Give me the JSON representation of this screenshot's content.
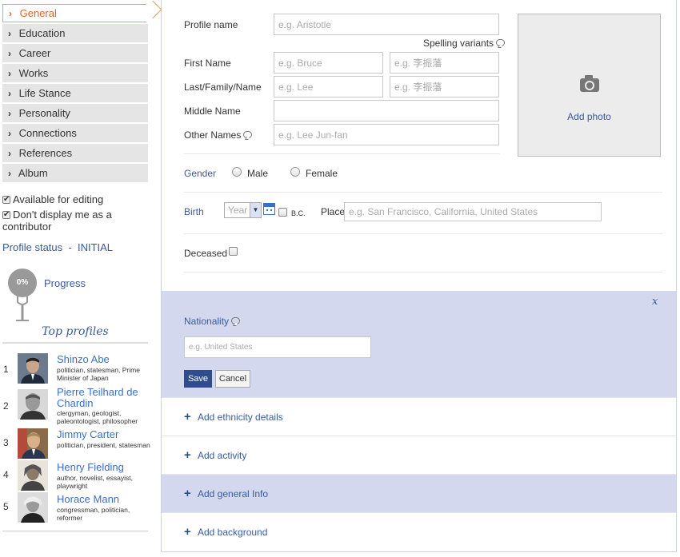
{
  "sidebar": {
    "nav": [
      {
        "label": "General",
        "active": true
      },
      {
        "label": "Education"
      },
      {
        "label": "Career"
      },
      {
        "label": "Works"
      },
      {
        "label": "Life Stance"
      },
      {
        "label": "Personality"
      },
      {
        "label": "Connections"
      },
      {
        "label": "References"
      },
      {
        "label": "Album"
      }
    ],
    "available_for_editing": "Available for editing",
    "dont_display": "Don't display me as a contributor",
    "profile_status_label": "Profile status",
    "profile_status_sep": "-",
    "profile_status_value": "INITIAL",
    "progress_badge": "0%",
    "progress_label": "Progress",
    "top_profiles_title": "Top profiles",
    "top_profiles": [
      {
        "rank": "1",
        "name": "Shinzo Abe",
        "desc": "politician, statesman, Prime Minister of Japan"
      },
      {
        "rank": "2",
        "name": "Pierre Teilhard de Chardin",
        "desc": "clergyman, geologist, paleontologist, philosopher"
      },
      {
        "rank": "3",
        "name": "Jimmy Carter",
        "desc": "politician, president, statesman"
      },
      {
        "rank": "4",
        "name": "Henry Fielding",
        "desc": "author, novelist, essayist, playwright"
      },
      {
        "rank": "5",
        "name": "Horace Mann",
        "desc": "congressman, politician, reformer"
      }
    ]
  },
  "form": {
    "profile_name_label": "Profile name",
    "profile_name_placeholder": "e.g. Aristotle",
    "spelling_variants": "Spelling variants",
    "first_name_label": "First Name",
    "first_name_placeholder": "e.g. Bruce",
    "first_name_alt_placeholder": "e.g. 李振藩",
    "last_name_label": "Last/Family/Name",
    "last_name_placeholder": "e.g. Lee",
    "last_name_alt_placeholder": "e.g. 李振藩",
    "middle_name_label": "Middle Name",
    "other_names_label": "Other Names",
    "other_names_placeholder": "e.g. Lee Jun-fan",
    "add_photo": "Add photo",
    "gender_label": "Gender",
    "male": "Male",
    "female": "Female",
    "birth_label": "Birth",
    "year_placeholder": "Year",
    "bc": "B.C.",
    "place_label": "Place",
    "place_placeholder": "e.g. San Francisco, California, United States",
    "deceased_label": "Deceased",
    "close": "x",
    "nationality_label": "Nationality",
    "nationality_placeholder": "e.g. United States",
    "save": "Save",
    "cancel": "Cancel",
    "add_rows": [
      "Add ethnicity details",
      "Add activity",
      "Add general Info",
      "Add background"
    ]
  },
  "colors": {
    "accent_orange": "#d9652b",
    "link_blue": "#3a5a9a",
    "panel_lavender": "#d3d8ee",
    "button_navy": "#2f4d8c"
  }
}
